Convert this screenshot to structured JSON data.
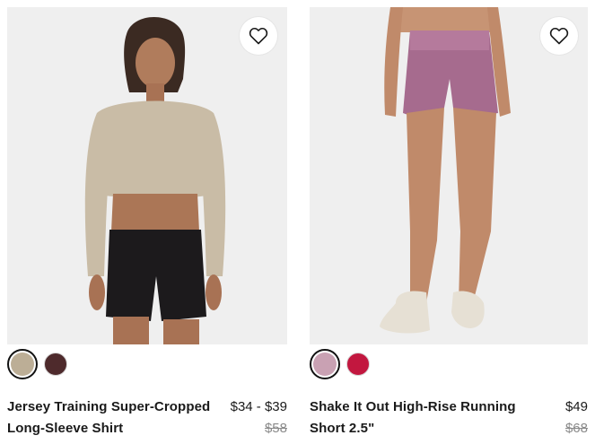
{
  "products": [
    {
      "title": "Jersey Training Super-Cropped Long-Sleeve Shirt",
      "price": "$34 - $39",
      "original_price": "$58",
      "favorite_icon": "heart-outline-icon",
      "swatches": [
        {
          "name": "khaki",
          "color": "#bcae96",
          "selected": true
        },
        {
          "name": "dark-plum",
          "color": "#4e2a2c",
          "selected": false
        }
      ]
    },
    {
      "title": "Shake It Out High-Rise Running Short 2.5\"",
      "price": "$49",
      "original_price": "$68",
      "favorite_icon": "heart-outline-icon",
      "swatches": [
        {
          "name": "dusty-pink",
          "color": "#c9a1b3",
          "selected": true
        },
        {
          "name": "raspberry",
          "color": "#c2173f",
          "selected": false
        }
      ]
    }
  ]
}
